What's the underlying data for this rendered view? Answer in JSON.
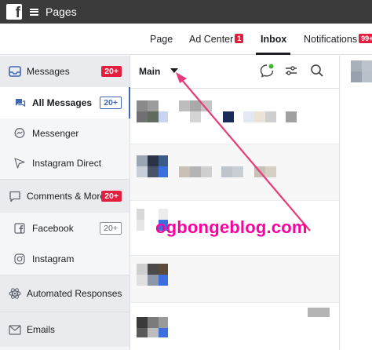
{
  "topbar": {
    "title": "Pages",
    "logo_letter": "f"
  },
  "tabs": [
    {
      "label": "Page"
    },
    {
      "label": "Ad Center",
      "badge": "1"
    },
    {
      "label": "Inbox",
      "active": true
    },
    {
      "label": "Notifications",
      "badge": "99+"
    }
  ],
  "sidebar": {
    "messages": {
      "label": "Messages",
      "count": "20+"
    },
    "all_messages": {
      "label": "All Messages",
      "count": "20+"
    },
    "messenger": {
      "label": "Messenger"
    },
    "instagram_direct": {
      "label": "Instagram Direct"
    },
    "comments": {
      "label": "Comments & More",
      "count": "20+"
    },
    "facebook": {
      "label": "Facebook",
      "count": "20+"
    },
    "instagram": {
      "label": "Instagram"
    },
    "automated": {
      "label": "Automated Responses"
    },
    "emails": {
      "label": "Emails"
    }
  },
  "main": {
    "title": "Main"
  },
  "watermark": "ogbongeblog.com",
  "colors": {
    "accent": "#4267b2",
    "badge_red": "#e41e3f",
    "watermark": "#ff00a0",
    "topbar": "#3b3b3b"
  }
}
